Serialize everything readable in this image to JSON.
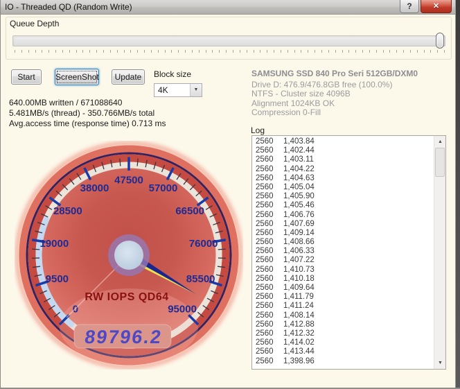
{
  "window": {
    "title": "IO - Threaded QD (Random Write)",
    "help_glyph": "?",
    "close_glyph": "✕"
  },
  "queue_depth": {
    "label": "Queue Depth",
    "thumb_position": "max",
    "tick_count": 64
  },
  "toolbar": {
    "start_label": "Start",
    "screenshot_label": "ScreenShot",
    "update_label": "Update",
    "block_size_label": "Block size",
    "block_size_value": "4K",
    "dropdown_glyph": "▼"
  },
  "stats": {
    "line1": "640.00MB written / 671088640",
    "line2": "5.481MB/s (thread) - 350.766MB/s total",
    "line3": "Avg.access time (response time) 0.713 ms"
  },
  "drive_info": {
    "title": "SAMSUNG SSD 840 Pro Seri 512GB/DXM0",
    "lines": [
      "Drive D: 476.9/476.8GB free (100.0%)",
      "NTFS - Cluster size 4096B",
      "Alignment 1024KB OK",
      "Compression 0-Fill"
    ]
  },
  "log": {
    "label": "Log",
    "scroll_up_glyph": "▲",
    "scroll_down_glyph": "▼",
    "rows": [
      {
        "qty": "2560",
        "value": "1,403.84"
      },
      {
        "qty": "2560",
        "value": "1,402.44"
      },
      {
        "qty": "2560",
        "value": "1,403.11"
      },
      {
        "qty": "2560",
        "value": "1,404.22"
      },
      {
        "qty": "2560",
        "value": "1,404.63"
      },
      {
        "qty": "2560",
        "value": "1,405.04"
      },
      {
        "qty": "2560",
        "value": "1,405.90"
      },
      {
        "qty": "2560",
        "value": "1,405.46"
      },
      {
        "qty": "2560",
        "value": "1,406.76"
      },
      {
        "qty": "2560",
        "value": "1,407.69"
      },
      {
        "qty": "2560",
        "value": "1,409.14"
      },
      {
        "qty": "2560",
        "value": "1,408.66"
      },
      {
        "qty": "2560",
        "value": "1,406.33"
      },
      {
        "qty": "2560",
        "value": "1,407.22"
      },
      {
        "qty": "2560",
        "value": "1,410.73"
      },
      {
        "qty": "2560",
        "value": "1,410.18"
      },
      {
        "qty": "2560",
        "value": "1,409.64"
      },
      {
        "qty": "2560",
        "value": "1,411.79"
      },
      {
        "qty": "2560",
        "value": "1,411.24"
      },
      {
        "qty": "2560",
        "value": "1,408.14"
      },
      {
        "qty": "2560",
        "value": "1,412.88"
      },
      {
        "qty": "2560",
        "value": "1,412.32"
      },
      {
        "qty": "2560",
        "value": "1,414.02"
      },
      {
        "qty": "2560",
        "value": "1,413.44"
      },
      {
        "qty": "2560",
        "value": "1,398.96"
      }
    ]
  },
  "gauge": {
    "title": "RW IOPS QD64",
    "min": 0,
    "max": 95000,
    "major_step": 9500,
    "minors_per_interval": 4,
    "value": 89796.2,
    "readout": "89796.2",
    "start_angle_deg": 135,
    "sweep_deg": 270,
    "colors": {
      "face_inner": "#c15149",
      "face_outer": "#dd7b70",
      "ring_white": "#eae4db",
      "ring_red": "#c54b42",
      "ring_navy": "#36215c",
      "ring_salmon": "#df7060",
      "glow": "#f4b9a9",
      "blue_arc": "#c2d8f2",
      "major_tick": "#1c3aa6",
      "minor_tick": "#3b3340",
      "label_text": "#1d2c94",
      "title_text": "#8b1111",
      "needle_navy": "#1b2590",
      "needle_yellow": "#e8e34f",
      "hub_ring": "#9678b2",
      "hub_face": "#cedbe9",
      "lcd_panel": "#dc958b",
      "lcd_digits": "#4b49c6"
    }
  }
}
